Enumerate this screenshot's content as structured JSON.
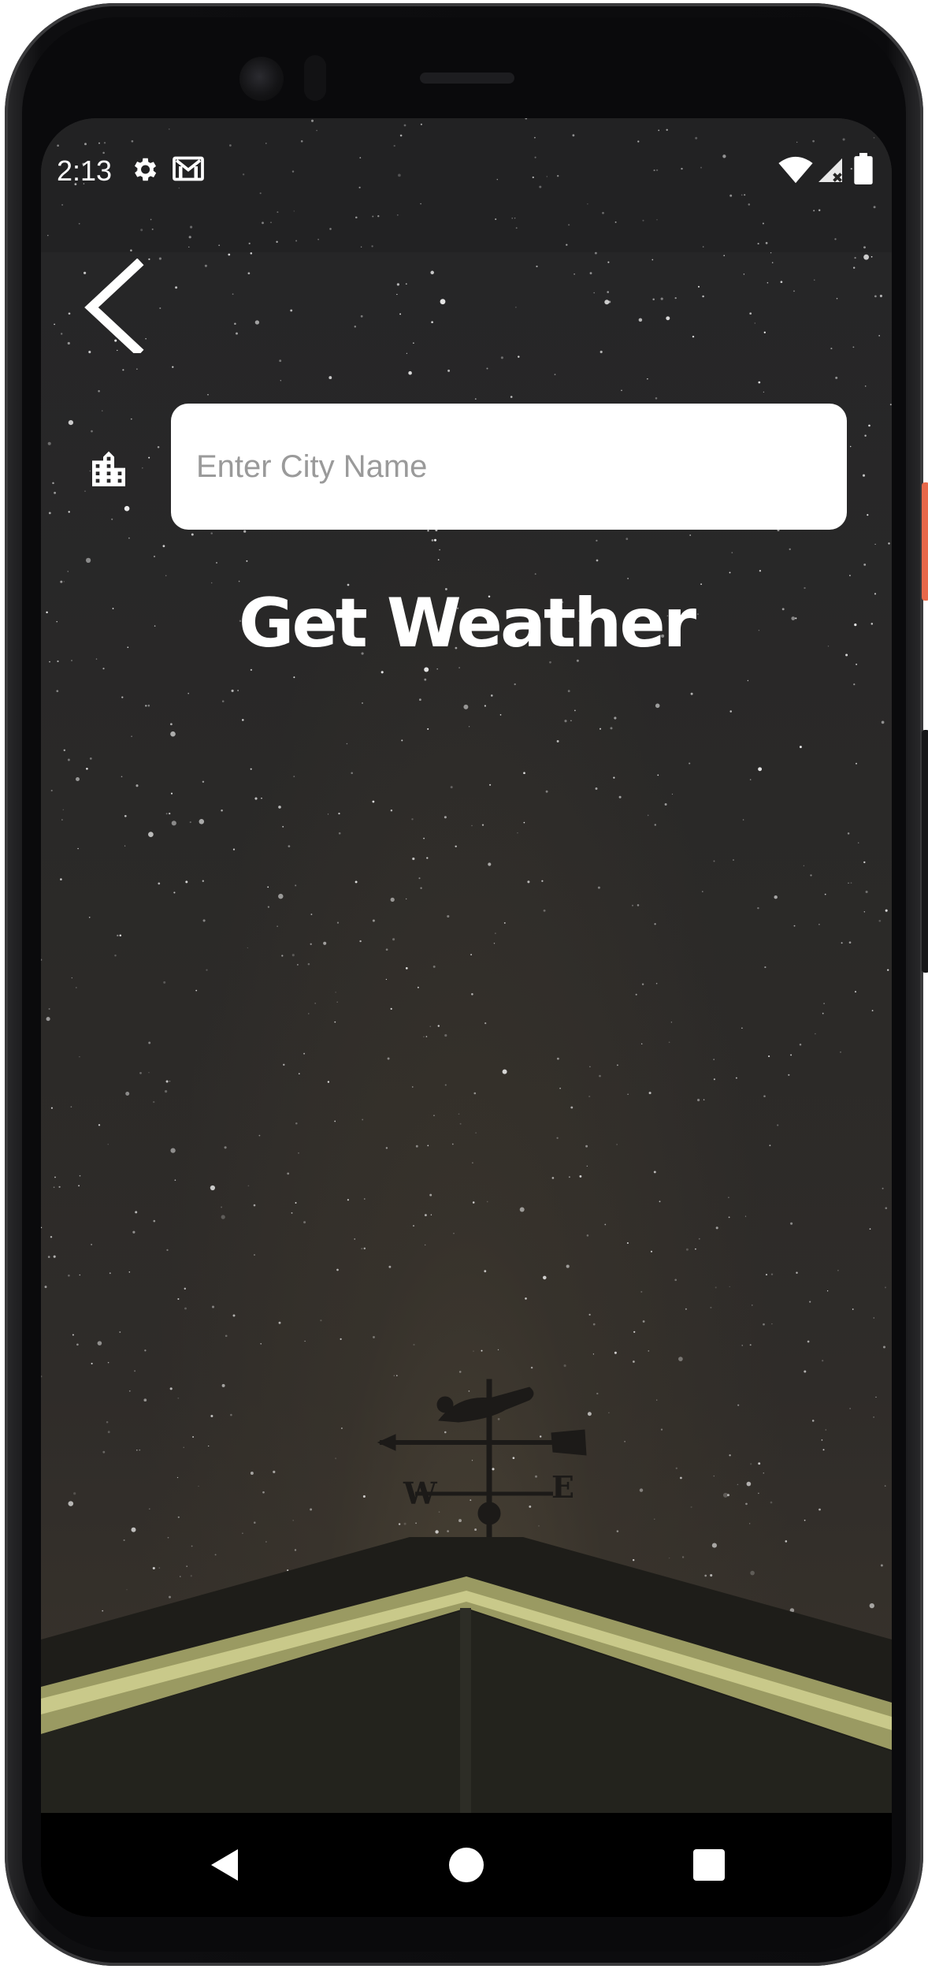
{
  "status_bar": {
    "time": "2:13",
    "left_icons": [
      "gear-icon",
      "gmail-icon"
    ],
    "right_icons": [
      "wifi-icon",
      "signal-icon",
      "battery-icon"
    ]
  },
  "back_button": {
    "icon": "chevron-left-icon"
  },
  "city_field": {
    "icon": "city-buildings-icon",
    "placeholder": "Enter City Name",
    "value": ""
  },
  "action": {
    "label": "Get Weather"
  },
  "weather_vane": {
    "west": "W",
    "east": "E"
  },
  "nav_bar": {
    "buttons": [
      "back-triangle-icon",
      "home-circle-icon",
      "recents-square-icon"
    ]
  },
  "colors": {
    "input_bg": "#ffffff",
    "title_text": "#ffffff",
    "sky": "#262524",
    "nav_bg": "#000000",
    "roof_trim": "#c9c98a"
  }
}
